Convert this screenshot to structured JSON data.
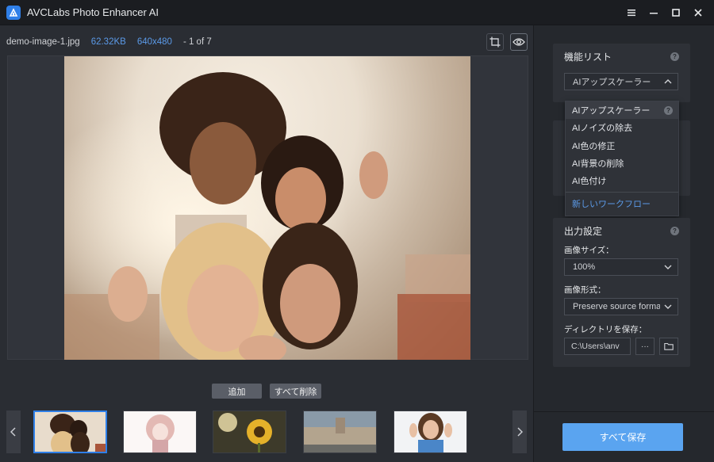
{
  "app": {
    "title": "AVCLabs Photo Enhancer AI"
  },
  "colors": {
    "accent": "#2f7fe8",
    "link": "#5b9ae8",
    "save_button": "#5aa4f0"
  },
  "icons": {
    "logo": "app-logo-icon",
    "window": [
      "menu-icon",
      "minimize-icon",
      "maximize-icon",
      "close-icon"
    ],
    "tools": [
      "crop-icon",
      "eye-icon"
    ],
    "nav": [
      "chevron-left-icon",
      "chevron-right-icon"
    ]
  },
  "file": {
    "name": "demo-image-1.jpg",
    "size": "62.32KB",
    "dimensions": "640x480",
    "index": "- 1 of 7"
  },
  "actions": {
    "add": "追加",
    "clear_all": "すべて削除"
  },
  "feature_list": {
    "title": "機能リスト",
    "selected": "AIアップスケーラー",
    "options": [
      "AIアップスケーラー",
      "AIノイズの除去",
      "AI色の修正",
      "AI背景の削除",
      "AI色付け"
    ],
    "new_workflow": "新しいワークフロー"
  },
  "output": {
    "title": "出力設定",
    "image_size_label": "画像サイズ：",
    "image_size_value": "100%",
    "image_format_label": "画像形式：",
    "image_format_value": "Preserve source format",
    "directory_label": "ディレクトリを保存：",
    "directory_value": "C:\\Users\\anv",
    "more_label": "···"
  },
  "save_all": "すべて保存",
  "thumbnails": [
    {
      "name": "thumb-group-selfie",
      "selected": true
    },
    {
      "name": "thumb-anime-girl",
      "selected": false
    },
    {
      "name": "thumb-sunflower",
      "selected": false
    },
    {
      "name": "thumb-city-street",
      "selected": false
    },
    {
      "name": "thumb-woman-peace",
      "selected": false
    }
  ]
}
